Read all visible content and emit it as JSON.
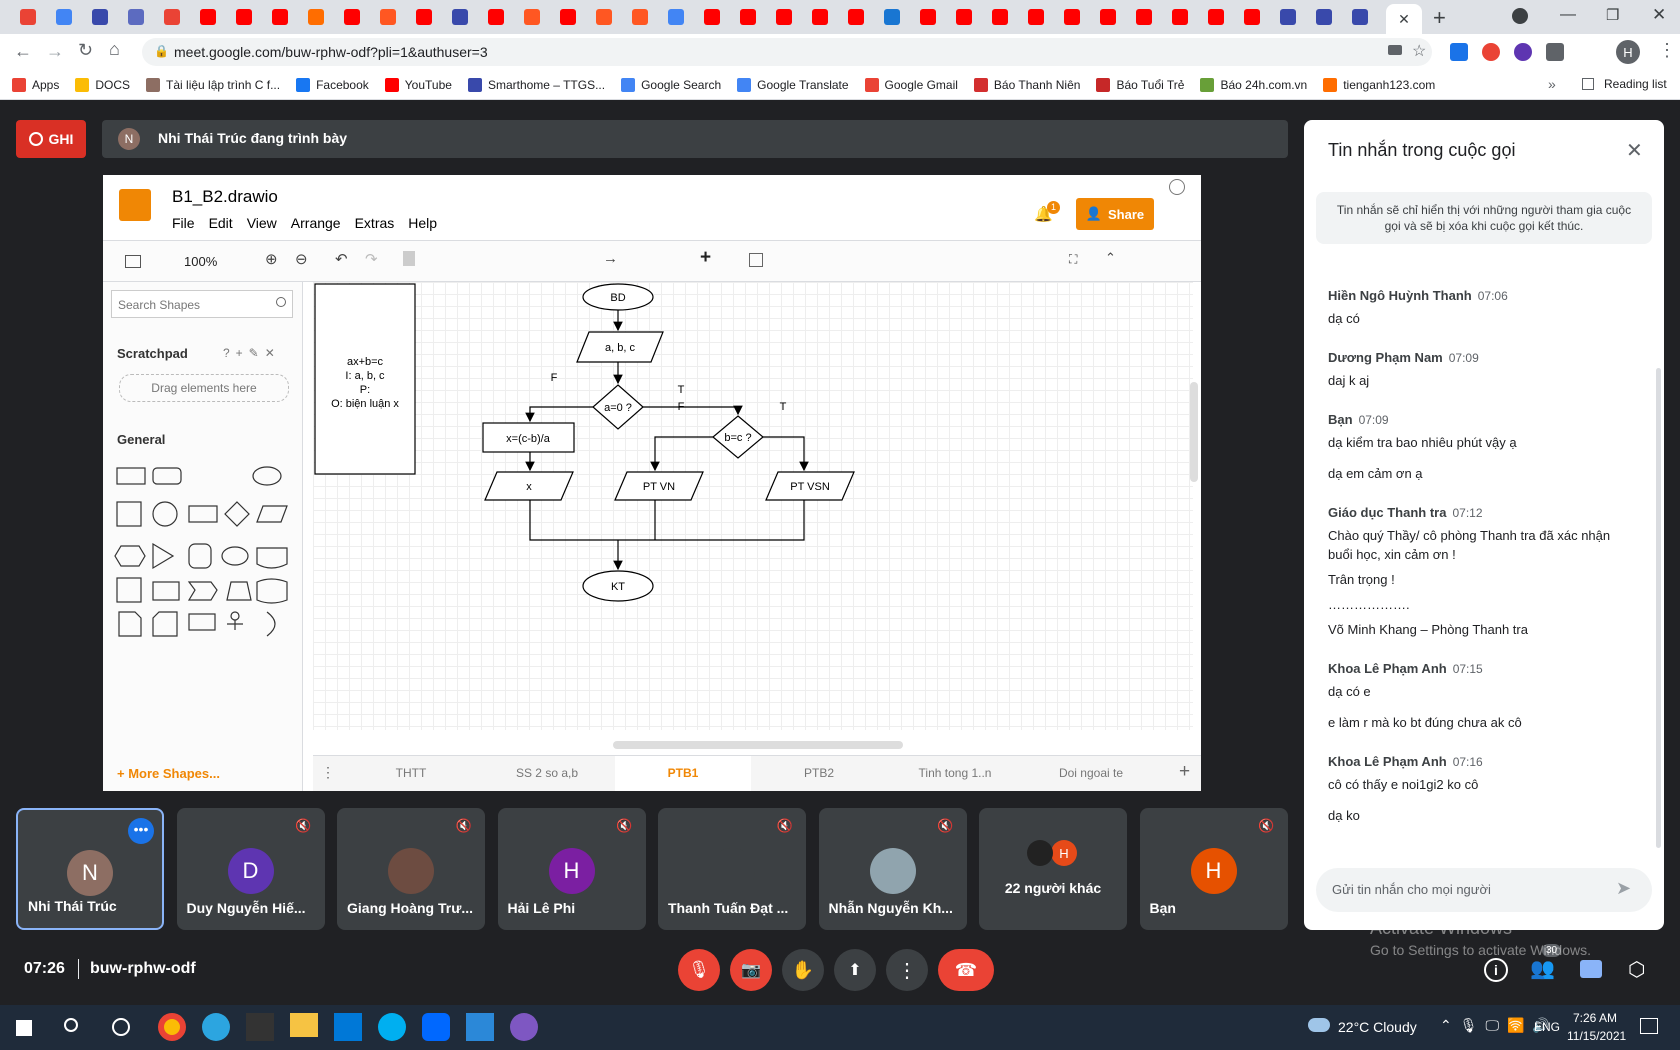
{
  "browser": {
    "url": "meet.google.com/buw-rphw-odf?pli=1&authuser=3",
    "bookmarks": [
      "Apps",
      "DOCS",
      "Tài liệu lập trình C f...",
      "Facebook",
      "YouTube",
      "Smarthome – TTGS...",
      "Google Search",
      "Google Translate",
      "Google Gmail",
      "Báo Thanh Niên",
      "Báo Tuổi Trẻ",
      "Báo 24h.com.vn",
      "tienganh123.com"
    ],
    "reading_list": "Reading list",
    "profile_initial": "H"
  },
  "meet": {
    "record_label": "GHI",
    "presenter_initial": "N",
    "presenter_banner": "Nhi Thái Trúc đang trình bày",
    "time": "07:26",
    "meeting_code": "buw-rphw-odf",
    "badge_count": "30",
    "watermark_line1": "Activate Windows",
    "watermark_line2": "Go to Settings to activate Windows."
  },
  "drawio": {
    "filename": "B1_B2.drawio",
    "menu": [
      "File",
      "Edit",
      "View",
      "Arrange",
      "Extras",
      "Help"
    ],
    "share": "Share",
    "notif_count": "1",
    "zoom": "100%",
    "search_placeholder": "Search Shapes",
    "scratchpad": "Scratchpad",
    "drag_here": "Drag elements here",
    "general": "General",
    "more_shapes": "+ More Shapes...",
    "pages": [
      "THTT",
      "SS 2 so a,b",
      "PTB1",
      "PTB2",
      "Tinh tong 1..n",
      "Doi ngoai te"
    ],
    "active_page": "PTB1",
    "diagram": {
      "note": [
        "ax+b=c",
        "I: a, b, c",
        "P:",
        "O: biện luận x"
      ],
      "start": "BD",
      "input": "a, b, c",
      "cond1": "a=0 ?",
      "cond2": "b=c ?",
      "assign": "x=(c-b)/a",
      "out_x": "x",
      "out_vn": "PT VN",
      "out_vsn": "PT VSN",
      "end": "KT",
      "label_f": "F",
      "label_t": "T"
    }
  },
  "participants": [
    {
      "name": "Nhi Thái Trúc",
      "initial": "N",
      "color": "#8d6e63"
    },
    {
      "name": "Duy Nguyễn Hiế...",
      "initial": "D",
      "color": "#5e35b1"
    },
    {
      "name": "Giang Hoàng Trư...",
      "initial": "",
      "color": "#6d4c41"
    },
    {
      "name": "Hải Lê Phi",
      "initial": "H",
      "color": "#7b1fa2"
    },
    {
      "name": "Thanh Tuấn Đạt ...",
      "initial": "",
      "color": "#3c4043"
    },
    {
      "name": "Nhẫn Nguyễn Kh...",
      "initial": "",
      "color": "#90a4ae"
    },
    {
      "name": "22 người khác",
      "initial": "H",
      "color": "#e64a19"
    },
    {
      "name": "Bạn",
      "initial": "H",
      "color": "#e65100"
    }
  ],
  "chat": {
    "title": "Tin nhắn trong cuộc gọi",
    "notice": "Tin nhắn sẽ chỉ hiển thị với những người tham gia cuộc gọi và sẽ bị xóa khi cuộc gọi kết thúc.",
    "messages": [
      {
        "author": "Hiền Ngô Huỳnh Thanh",
        "time": "07:06",
        "lines": [
          "dạ có"
        ]
      },
      {
        "author": "Dương Phạm Nam",
        "time": "07:09",
        "lines": [
          "daj k aj"
        ]
      },
      {
        "author": "Bạn",
        "time": "07:09",
        "lines": [
          "dạ kiểm tra bao nhiêu phút vậy ạ",
          "dạ em cảm ơn ạ"
        ]
      },
      {
        "author": "Giáo dục Thanh tra",
        "time": "07:12",
        "lines": [
          "Chào quý Thầy/ cô phòng Thanh tra đã xác nhận buổi học, xin cảm ơn !",
          "Trân trọng !",
          "……………….",
          "Võ Minh Khang – Phòng Thanh tra"
        ]
      },
      {
        "author": "Khoa Lê Phạm Anh",
        "time": "07:15",
        "lines": [
          "dạ có e",
          "e làm r mà ko bt đúng chưa ak cô"
        ]
      },
      {
        "author": "Khoa Lê Phạm Anh",
        "time": "07:16",
        "lines": [
          "cô có thấy e noi1gi2 ko cô",
          "dạ ko"
        ]
      }
    ],
    "input_placeholder": "Gửi tin nhắn cho mọi người"
  },
  "taskbar": {
    "weather": "22°C  Cloudy",
    "lang": "ENG",
    "clock_time": "7:26 AM",
    "clock_date": "11/15/2021"
  }
}
